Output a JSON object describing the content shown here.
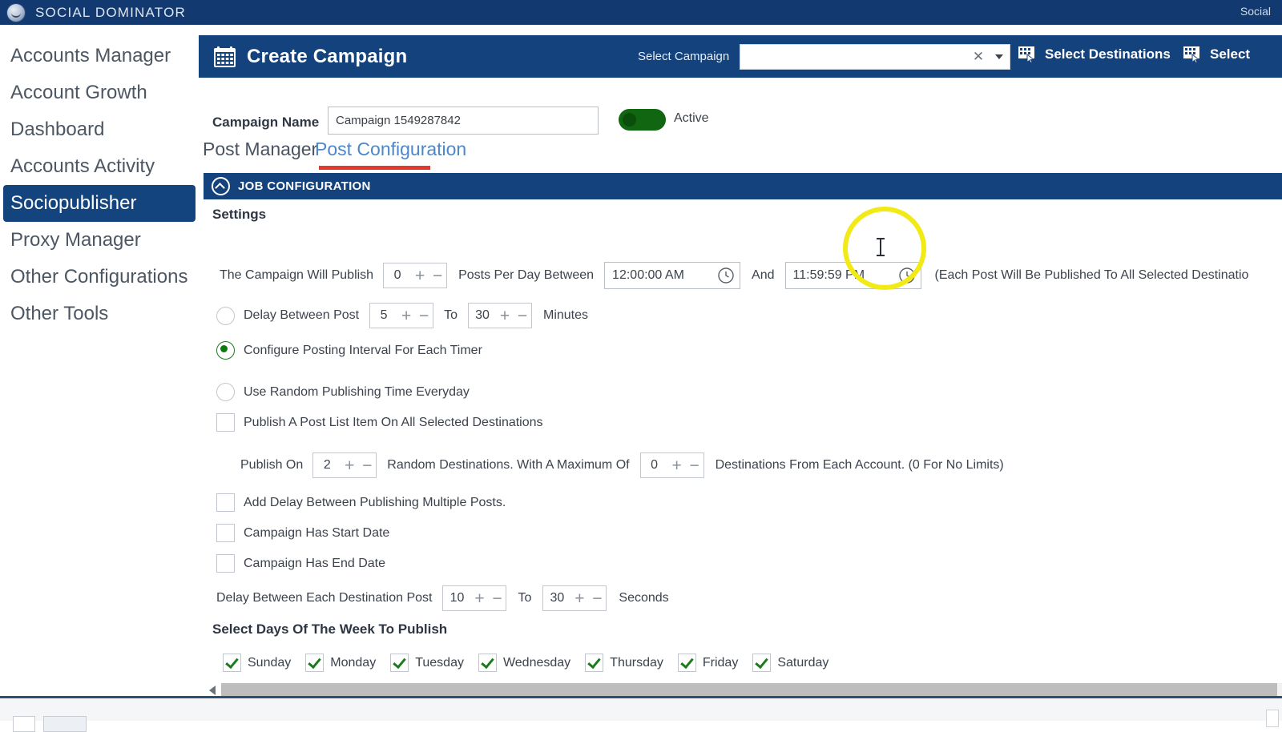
{
  "titlebar": {
    "app_name": "SOCIAL DOMINATOR",
    "right_label": "Social",
    "logo_icon": "smiley-globe-icon",
    "bg": "#123a70"
  },
  "sidebar": {
    "items": [
      {
        "label": "Accounts Manager",
        "active": false
      },
      {
        "label": "Account Growth",
        "active": false
      },
      {
        "label": "Dashboard",
        "active": false
      },
      {
        "label": "Accounts Activity",
        "active": false
      },
      {
        "label": "Sociopublisher",
        "active": true
      },
      {
        "label": "Proxy Manager",
        "active": false
      },
      {
        "label": "Other Configurations",
        "active": false
      },
      {
        "label": "Other Tools",
        "active": false
      }
    ]
  },
  "panel_header": {
    "icon": "calendar-icon",
    "title": "Create Campaign",
    "select_campaign_label": "Select Campaign",
    "combo_value": "",
    "combo_placeholder": "",
    "clear_icon": "close-x-icon",
    "dropdown_icon": "chevron-down-icon",
    "buttons": [
      {
        "label": "Select Destinations",
        "icon": "destinations-grid-cursor-icon"
      },
      {
        "label": "Select",
        "icon": "destinations-grid-cursor-icon"
      }
    ]
  },
  "campaign": {
    "name_label": "Campaign Name",
    "name_value": "Campaign 1549287842",
    "toggle_state_label": "Active",
    "toggle_on": true,
    "toggle_color": "#116611"
  },
  "tabs": {
    "items": [
      {
        "label": "Post Manager",
        "selected": false
      },
      {
        "label": "Post Configuration",
        "selected": true
      }
    ],
    "underline_color": "#e03a2f",
    "selected_color": "#4c87c9"
  },
  "job_config": {
    "bar_title": "JOB CONFIGURATION",
    "collapse_icon": "chevron-up-circle-icon",
    "settings_heading": "Settings",
    "publish_row": {
      "prefix": "The Campaign Will Publish",
      "posts_per_day": "0",
      "middle": "Posts Per Day Between",
      "time_from": "12:00:00 AM",
      "and": "And",
      "time_to": "11:59:59 PM",
      "note": "(Each Post Will Be Published To All Selected Destinatio",
      "clock_icon": "clock-icon",
      "plus_icon": "plus-icon",
      "minus_icon": "minus-icon"
    },
    "delay_between_post": {
      "label": "Delay Between Post",
      "from": "5",
      "to_label": "To",
      "to": "30",
      "unit": "Minutes",
      "selected": false
    },
    "configure_interval": {
      "label": "Configure Posting Interval For Each Timer",
      "selected": true
    },
    "random_publishing": {
      "label": "Use Random Publishing Time Everyday",
      "selected": false
    },
    "publish_post_list": {
      "label": "Publish A Post List Item On All Selected Destinations",
      "checked": false
    },
    "publish_on_row": {
      "prefix": "Publish On",
      "random_destinations": "2",
      "middle": "Random Destinations. With A Maximum Of",
      "max_destinations": "0",
      "suffix": "Destinations From Each Account. (0 For No Limits)"
    },
    "add_delay": {
      "label": "Add Delay Between Publishing Multiple Posts.",
      "checked": false
    },
    "has_start_date": {
      "label": "Campaign Has Start Date",
      "checked": false
    },
    "has_end_date": {
      "label": "Campaign Has End Date",
      "checked": false
    },
    "destination_delay": {
      "label": "Delay Between Each Destination Post",
      "from": "10",
      "to_label": "To",
      "to": "30",
      "unit": "Seconds"
    },
    "days_heading": "Select Days Of The Week To Publish",
    "days": [
      {
        "label": "Sunday",
        "checked": true
      },
      {
        "label": "Monday",
        "checked": true
      },
      {
        "label": "Tuesday",
        "checked": true
      },
      {
        "label": "Wednesday",
        "checked": true
      },
      {
        "label": "Thursday",
        "checked": true
      },
      {
        "label": "Friday",
        "checked": true
      },
      {
        "label": "Saturday",
        "checked": true
      }
    ]
  },
  "scrollbar": {
    "left_arrow_icon": "arrow-left-icon"
  },
  "annotation": {
    "highlight_color": "#f2ea17",
    "highlight_target": "time_to field"
  }
}
